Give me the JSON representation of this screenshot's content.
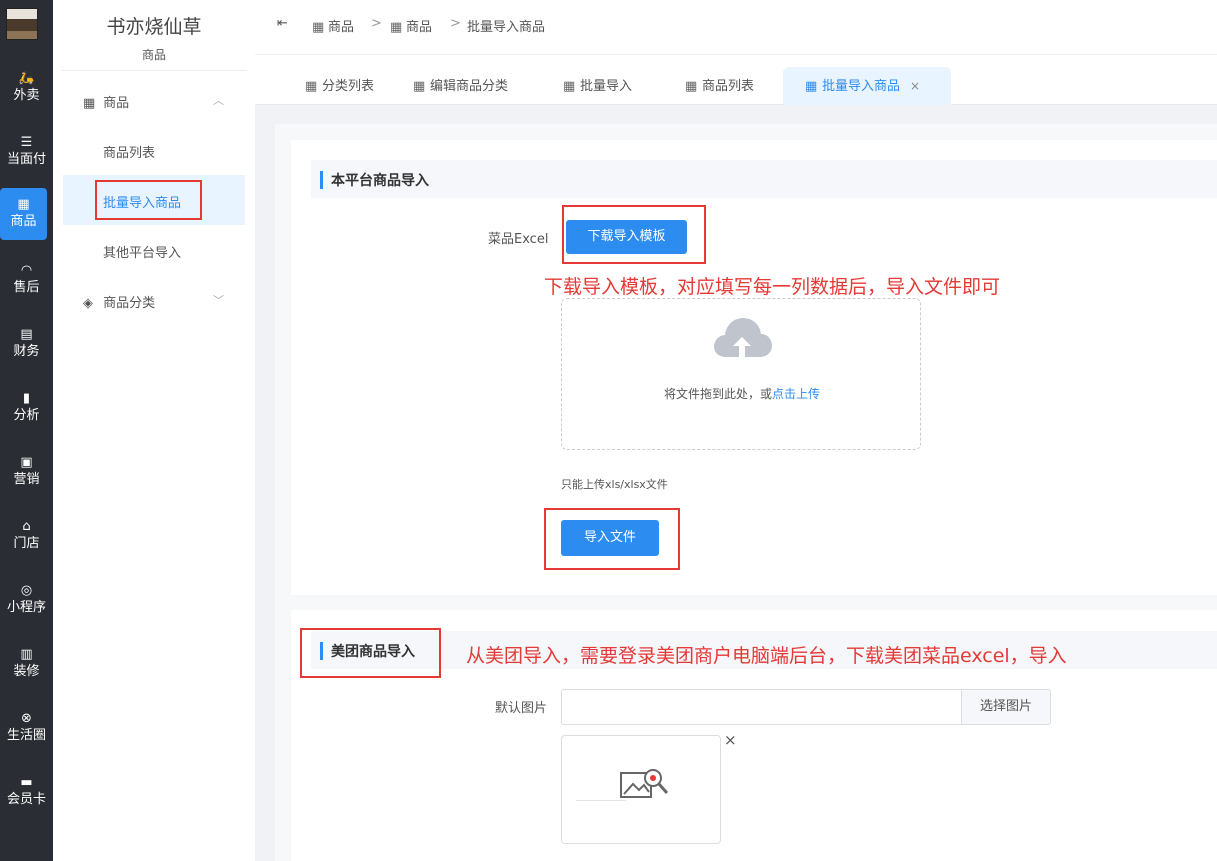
{
  "rail": {
    "items": [
      {
        "icon": "🛵",
        "label": "外卖"
      },
      {
        "icon": "☰",
        "label": "当面付"
      },
      {
        "icon": "▦",
        "label": "商品"
      },
      {
        "icon": "◠",
        "label": "售后"
      },
      {
        "icon": "▤",
        "label": "财务"
      },
      {
        "icon": "▮",
        "label": "分析"
      },
      {
        "icon": "▣",
        "label": "营销"
      },
      {
        "icon": "⌂",
        "label": "门店"
      },
      {
        "icon": "◎",
        "label": "小程序"
      },
      {
        "icon": "▥",
        "label": "装修"
      },
      {
        "icon": "⊗",
        "label": "生活圈"
      },
      {
        "icon": "▬",
        "label": "会员卡"
      }
    ],
    "active_index": 2
  },
  "side": {
    "shop_name": "书亦烧仙草",
    "section": "商品",
    "groups": [
      {
        "icon": "▦",
        "label": "商品",
        "chevron": "︿"
      },
      {
        "icon": "◈",
        "label": "商品分类",
        "chevron": "﹀"
      }
    ],
    "items": [
      "商品列表",
      "批量导入商品",
      "其他平台导入"
    ]
  },
  "header": {
    "toggle": "⇤",
    "crumbs": [
      {
        "icon": "▦",
        "label": "商品"
      },
      {
        "icon": "▦",
        "label": "商品"
      },
      {
        "icon": "",
        "label": "批量导入商品"
      }
    ],
    "sep": ">"
  },
  "tabs": [
    {
      "icon": "▦",
      "label": "分类列表"
    },
    {
      "icon": "▦",
      "label": "编辑商品分类"
    },
    {
      "icon": "▦",
      "label": "批量导入"
    },
    {
      "icon": "▦",
      "label": "商品列表"
    },
    {
      "icon": "▦",
      "label": "批量导入商品",
      "close": "×"
    }
  ],
  "section1": {
    "title": "本平台商品导入",
    "field_label": "菜品Excel",
    "download_btn": "下载导入模板",
    "annotation": "下载导入模板，对应填写每一列数据后，导入文件即可",
    "upload_hint": "将文件拖到此处，或",
    "upload_link": "点击上传",
    "tip": "只能上传xls/xlsx文件",
    "import_btn": "导入文件"
  },
  "section2": {
    "title": "美团商品导入",
    "annotation": "从美团导入，需要登录美团商户电脑端后台，下载美团菜品excel，导入",
    "field_label": "默认图片",
    "input_value": "",
    "choose_btn": "选择图片",
    "remove": "×"
  },
  "colors": {
    "accent": "#2d8cf0",
    "annotation_red": "#e53935",
    "rail_bg": "#2a2d33"
  }
}
